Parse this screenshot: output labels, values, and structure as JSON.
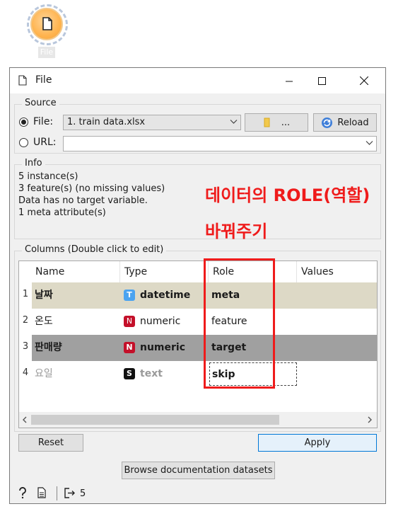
{
  "node": {
    "label": "File"
  },
  "window": {
    "title": "File"
  },
  "source": {
    "title": "Source",
    "file_label": "File:",
    "file_value": "1. train data.xlsx",
    "browse_label": "...",
    "reload_label": "Reload",
    "url_label": "URL:",
    "url_value": ""
  },
  "info": {
    "title": "Info",
    "lines": [
      "5 instance(s)",
      "3 feature(s) (no missing values)",
      "Data has no target variable.",
      "1 meta attribute(s)"
    ]
  },
  "annotation": {
    "line1": "데이터의 ROLE(역할)",
    "line2": "바꿔주기",
    "color": "#ef1b1b"
  },
  "columns": {
    "title": "Columns (Double click to edit)",
    "headers": [
      "Name",
      "Type",
      "Role",
      "Values"
    ],
    "rows": [
      {
        "num": "1",
        "name": "날짜",
        "type_icon": "T",
        "type": "datetime",
        "role": "meta",
        "values": ""
      },
      {
        "num": "2",
        "name": "온도",
        "type_icon": "N",
        "type": "numeric",
        "role": "feature",
        "values": ""
      },
      {
        "num": "3",
        "name": "판매량",
        "type_icon": "N",
        "type": "numeric",
        "role": "target",
        "values": ""
      },
      {
        "num": "4",
        "name": "요일",
        "type_icon": "S",
        "type": "text",
        "role": "skip",
        "values": ""
      }
    ]
  },
  "buttons": {
    "reset": "Reset",
    "apply": "Apply",
    "browse_docs": "Browse documentation datasets"
  },
  "status": {
    "output_count": "5"
  }
}
